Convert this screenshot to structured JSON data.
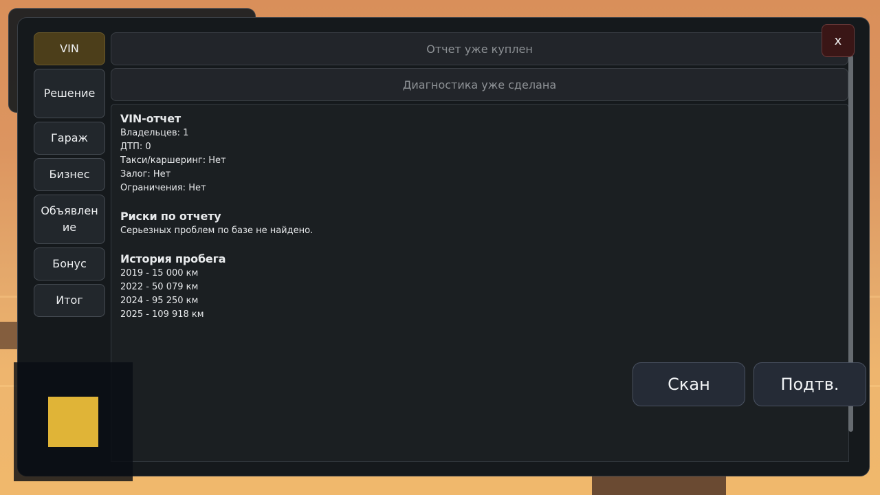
{
  "colors": {
    "active_tab": "#4c3e1a",
    "close_button": "#3a1616",
    "minimap_marker": "#e0b437",
    "panel_bg": "#15191c"
  },
  "sidebar": {
    "items": [
      {
        "label": "VIN",
        "active": true
      },
      {
        "label": "Решение",
        "active": false
      },
      {
        "label": "Гараж",
        "active": false
      },
      {
        "label": "Бизнес",
        "active": false
      },
      {
        "label": "Объявление",
        "active": false
      },
      {
        "label": "Бонус",
        "active": false
      },
      {
        "label": "Итог",
        "active": false
      }
    ]
  },
  "status": {
    "report": "Отчет уже куплен",
    "diagnostics": "Диагностика уже сделана"
  },
  "report": {
    "vin_title": "VIN-отчет",
    "vin_lines": [
      "Владельцев: 1",
      "ДТП: 0",
      "Такси/каршеринг: Нет",
      "Залог: Нет",
      "Ограничения: Нет"
    ],
    "risks_title": "Риски по отчету",
    "risks_lines": [
      "Серьезных проблем по базе не найдено."
    ],
    "mileage_title": "История пробега",
    "mileage_lines": [
      "2019 - 15 000 км",
      "2022 - 50 079 км",
      "2024 - 95 250 км",
      "2025 - 109 918 км"
    ]
  },
  "buttons": {
    "close": "x",
    "scan": "Скан",
    "confirm": "Подтв."
  },
  "minimap": {
    "marker_icon": "player-marker-square"
  }
}
